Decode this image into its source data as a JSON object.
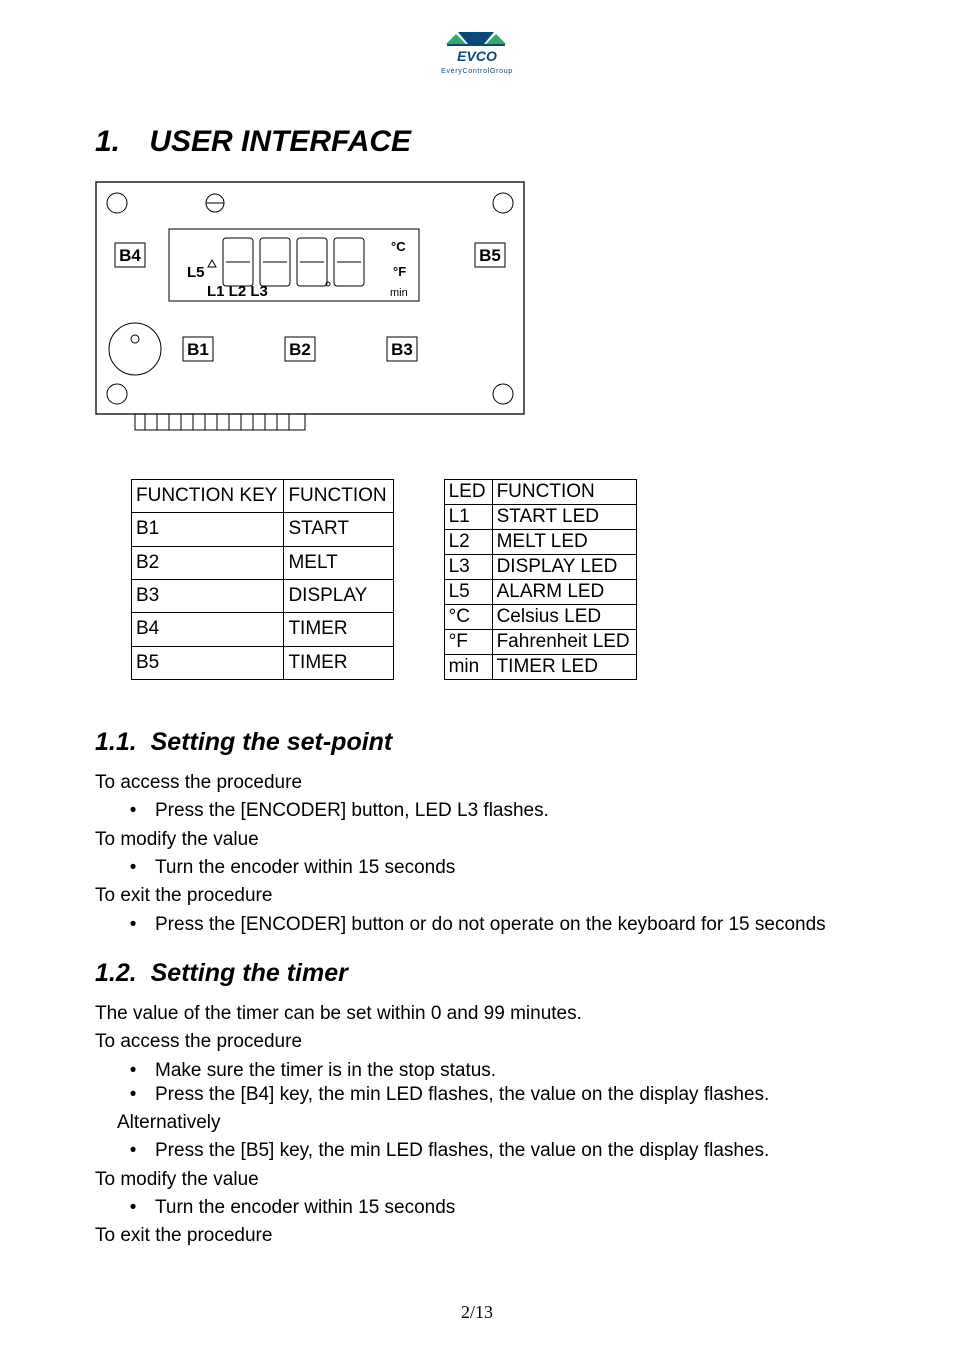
{
  "logo": {
    "brand": "EVCO",
    "subtitle": "EveryControlGroup"
  },
  "section1": {
    "num": "1.",
    "title": "USER INTERFACE"
  },
  "diagram": {
    "b1": "B1",
    "b2": "B2",
    "b3": "B3",
    "b4": "B4",
    "b5": "B5",
    "l5": "L5",
    "l1l2l3": "L1 L2 L3",
    "unit_c": "°C",
    "unit_f": "°F",
    "unit_min": "min"
  },
  "table_keys": {
    "header": [
      "FUNCTION KEY",
      "FUNCTION"
    ],
    "rows": [
      [
        "B1",
        "START"
      ],
      [
        "B2",
        "MELT"
      ],
      [
        "B3",
        "DISPLAY"
      ],
      [
        "B4",
        "TIMER"
      ],
      [
        "B5",
        "TIMER"
      ]
    ]
  },
  "table_leds": {
    "header": [
      "LED",
      "FUNCTION"
    ],
    "rows": [
      [
        "L1",
        "START LED"
      ],
      [
        "L2",
        "MELT LED"
      ],
      [
        "L3",
        "DISPLAY LED"
      ],
      [
        "L5",
        "ALARM LED"
      ],
      [
        "°C",
        "Celsius LED"
      ],
      [
        "°F",
        "Fahrenheit LED"
      ],
      [
        "min",
        "TIMER LED"
      ]
    ]
  },
  "sub11": {
    "num": "1.1.",
    "title": "Setting the set-point"
  },
  "sub11_body": {
    "l1": "To access the procedure",
    "b1": "Press the [ENCODER] button, LED L3 flashes.",
    "l2": "To modify the value",
    "b2": "Turn the encoder within 15 seconds",
    "l3": "To exit the procedure",
    "b3": "Press the [ENCODER] button or do not operate on the keyboard for 15 seconds"
  },
  "sub12": {
    "num": "1.2.",
    "title": "Setting the timer"
  },
  "sub12_body": {
    "p1": "The value of the timer can be set within 0 and 99 minutes.",
    "l1": "To access the procedure",
    "b1": "Make sure the timer is in the stop status.",
    "b2": "Press the [B4] key, the min LED flashes, the value on the display flashes.",
    "alt": "Alternatively",
    "b3": "Press the [B5] key, the min LED flashes, the value on the display flashes.",
    "l2": "To modify the value",
    "b4": "Turn the encoder within 15 seconds",
    "l3": "To exit the procedure"
  },
  "footer": {
    "page": "2/13"
  }
}
